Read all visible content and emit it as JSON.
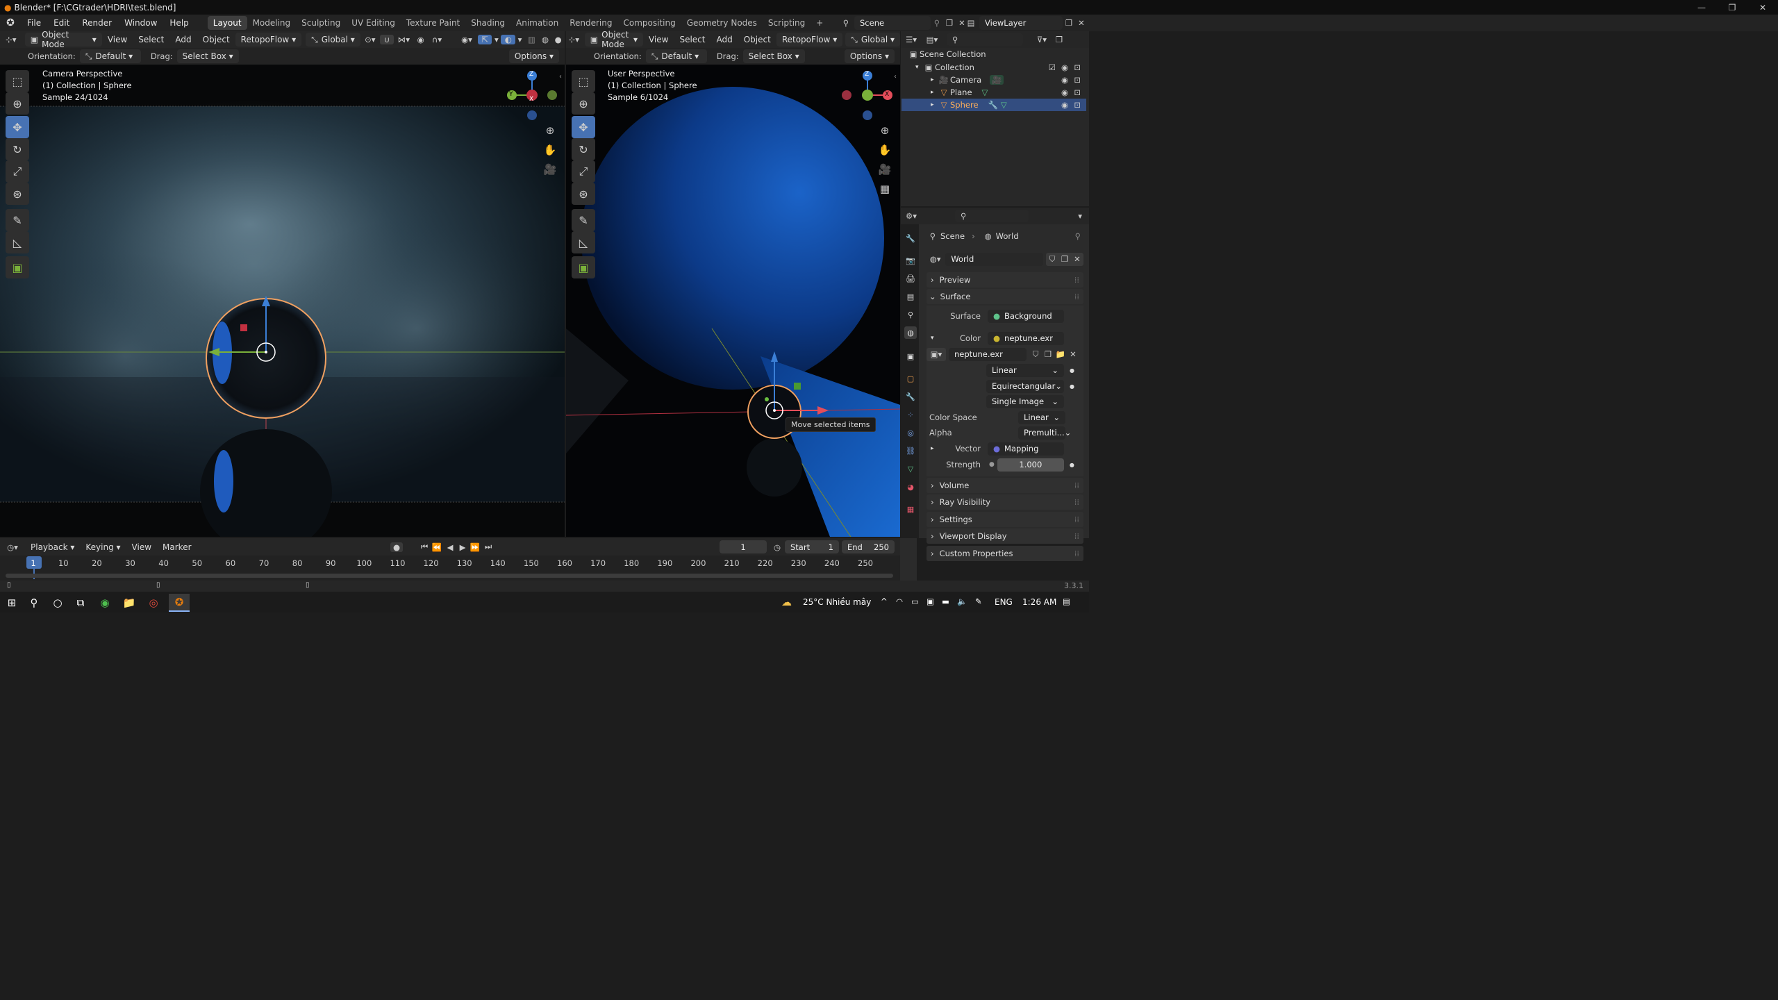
{
  "window": {
    "title": "Blender* [F:\\CGtrader\\HDRI\\test.blend]",
    "minimize": "—",
    "maximize": "❐",
    "close": "✕"
  },
  "menu": [
    "File",
    "Edit",
    "Render",
    "Window",
    "Help"
  ],
  "workspaces": [
    "Layout",
    "Modeling",
    "Sculpting",
    "UV Editing",
    "Texture Paint",
    "Shading",
    "Animation",
    "Rendering",
    "Compositing",
    "Geometry Nodes",
    "Scripting"
  ],
  "add_workspace": "+",
  "scene": {
    "label": "Scene"
  },
  "viewlayer": {
    "label": "ViewLayer"
  },
  "left_view": {
    "mode": "Object Mode",
    "menus": [
      "View",
      "Select",
      "Add",
      "Object",
      "RetopoFlow"
    ],
    "transform": "Global",
    "orientation_label": "Orientation:",
    "orientation": "Default",
    "drag_label": "Drag:",
    "drag": "Select Box",
    "options": "Options",
    "overlay": [
      "Camera Perspective",
      "(1) Collection | Sphere",
      "Sample 24/1024"
    ],
    "gizmo": {
      "z": "Z",
      "y": "Y",
      "x": "X"
    }
  },
  "right_view": {
    "mode": "Object Mode",
    "menus": [
      "View",
      "Select",
      "Add",
      "Object",
      "RetopoFlow"
    ],
    "transform": "Global",
    "orientation_label": "Orientation:",
    "orientation": "Default",
    "drag_label": "Drag:",
    "drag": "Select Box",
    "options": "Options",
    "overlay": [
      "User Perspective",
      "(1) Collection | Sphere",
      "Sample 6/1024"
    ],
    "tooltip": "Move selected items",
    "gizmo": {
      "z": "Z",
      "x": "X"
    }
  },
  "outliner": {
    "items": [
      {
        "label": "Scene Collection"
      },
      {
        "label": "Collection"
      },
      {
        "label": "Camera"
      },
      {
        "label": "Plane"
      },
      {
        "label": "Sphere"
      }
    ]
  },
  "properties": {
    "breadcrumb": [
      "Scene",
      "World"
    ],
    "world_name": "World",
    "panels": {
      "preview": "Preview",
      "surface": "Surface",
      "volume": "Volume",
      "ray_visibility": "Ray Visibility",
      "settings": "Settings",
      "viewport_display": "Viewport Display",
      "custom_properties": "Custom Properties"
    },
    "surface_label": "Surface",
    "surface_value": "Background",
    "color_label": "Color",
    "color_value": "neptune.exr",
    "image_name": "neptune.exr",
    "interpolation": "Linear",
    "projection": "Equirectangular",
    "source": "Single Image",
    "color_space_label": "Color Space",
    "color_space": "Linear",
    "alpha_label": "Alpha",
    "alpha": "Premulti...",
    "vector_label": "Vector",
    "vector_value": "Mapping",
    "strength_label": "Strength",
    "strength": "1.000"
  },
  "timeline": {
    "menus": [
      "Playback",
      "Keying",
      "View",
      "Marker"
    ],
    "current_frame": "1",
    "start_label": "Start",
    "start": "1",
    "end_label": "End",
    "end": "250",
    "ticks": [
      "1",
      "10",
      "20",
      "30",
      "40",
      "50",
      "60",
      "70",
      "80",
      "90",
      "100",
      "110",
      "120",
      "130",
      "140",
      "150",
      "160",
      "170",
      "180",
      "190",
      "200",
      "210",
      "220",
      "230",
      "240",
      "250"
    ]
  },
  "version": "3.3.1",
  "taskbar": {
    "weather": "25°C  Nhiều mây",
    "language": "ENG",
    "time": "1:26 AM"
  },
  "colors": {
    "accent": "#4772b3",
    "selected_orange": "#f0a060",
    "x_axis": "#e44d5a",
    "y_axis": "#7ab03a",
    "z_axis": "#3b7fd6"
  }
}
